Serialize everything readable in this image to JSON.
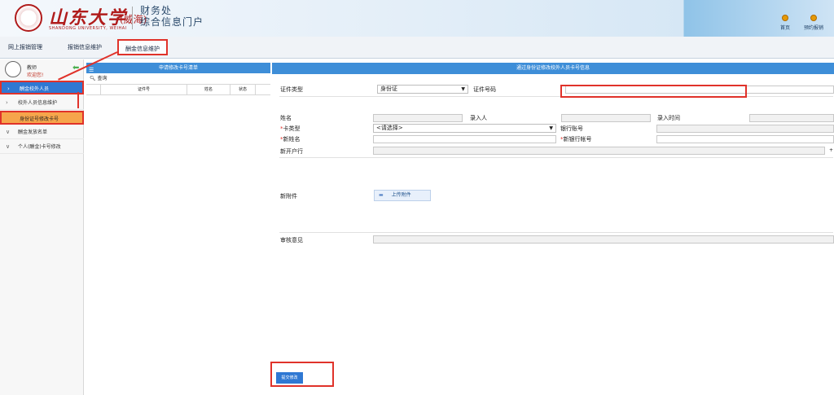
{
  "header": {
    "logo_text": "山东大学",
    "logo_sub": "(威海)",
    "logo_en": "SHANDONG UNIVERSITY, WEIHAI",
    "title_line1": "财务处",
    "title_line2": "综合信息门户",
    "btn_home": "首页",
    "btn_booking": "预约报销"
  },
  "nav": {
    "items": [
      "网上报销管理",
      "报销信息维护",
      "酬金信息维护"
    ]
  },
  "sidebar": {
    "user_role": "教师",
    "user_welcome": "欢迎您!",
    "items": [
      "酬金校外人员",
      "校外人员信息维护",
      "身份证号修改卡号",
      "酬金发放名单",
      "个人(酬金)卡号修改"
    ]
  },
  "list_panel": {
    "title": "申请修改卡号清单",
    "query_label": "查询",
    "columns": [
      "证件号",
      "姓名",
      "状态"
    ]
  },
  "form": {
    "title": "通过身份证修改校外人员卡号信息",
    "cert_type_label": "证件类型",
    "cert_type_value": "身份证",
    "cert_no_label": "证件号码",
    "name_label": "姓名",
    "entered_by_label": "录入人",
    "entry_time_label": "录入时间",
    "card_type_label": "卡类型",
    "card_type_value": "<请选择>",
    "bank_account_label": "银行账号",
    "new_name_label": "新姓名",
    "new_bank_account_label": "新银行帐号",
    "new_bank_label": "新开户行",
    "new_attachment_label": "新附件",
    "upload_label": "上传附件",
    "review_label": "审核意见",
    "submit_label": "提交修改"
  },
  "colors": {
    "accent": "#3e8ed8",
    "highlight": "#e0322a",
    "sidebar_active": "#2f78d3",
    "sidebar_selected": "#f6a54b"
  }
}
